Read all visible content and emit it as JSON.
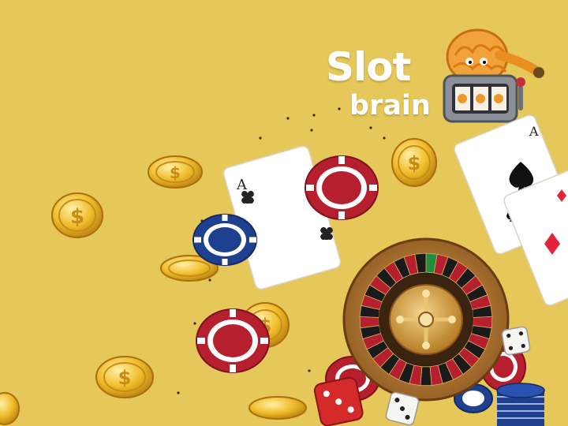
{
  "logo": {
    "word_1": "Slot",
    "word_2": "brain"
  },
  "cards": {
    "rank": "A",
    "suits": [
      "clubs-icon",
      "spades-icon",
      "diamonds-icon"
    ]
  },
  "coin_symbol": "$",
  "colors": {
    "background": "#e5c75a",
    "gold": "#f0bc2a",
    "chip_red": "#b51f2e",
    "chip_blue": "#1f3f8f",
    "roulette_green": "#1f8f3a"
  }
}
